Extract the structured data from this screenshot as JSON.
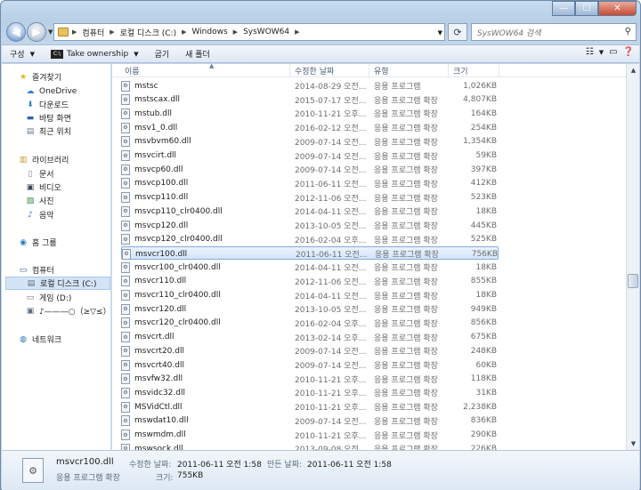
{
  "window": {
    "min_glyph": "—",
    "max_glyph": "☐",
    "close_glyph": "✕"
  },
  "address": {
    "path": [
      "컴퓨터",
      "로컬 디스크 (C:)",
      "Windows",
      "SysWOW64"
    ],
    "search_placeholder": "SysWOW64 검색"
  },
  "toolbar": {
    "organize": "구성",
    "take_ownership_icon": "C:\\",
    "take_ownership": "Take ownership",
    "burn": "굽기",
    "new_folder": "새 폴더"
  },
  "nav": {
    "favorites": "즐겨찾기",
    "onedrive": "OneDrive",
    "downloads": "다운로드",
    "desktop": "바탕 화면",
    "recent": "최근 위치",
    "libraries": "라이브러리",
    "documents": "문서",
    "videos": "비디오",
    "pictures": "사진",
    "music": "음악",
    "homegroup": "홈 그룹",
    "computer": "컴퓨터",
    "local_disk": "로컬 디스크 (C:)",
    "game_drive": "게임 (D:)",
    "odd_drive": "♪———○（≥▽≤）",
    "network": "네트워크"
  },
  "columns": {
    "name": "이름",
    "date": "수정한 날짜",
    "type": "유형",
    "size": "크기"
  },
  "files": [
    {
      "name": "mstsc",
      "date": "2014-08-29 오전...",
      "type": "응용 프로그램",
      "size": "1,026KB"
    },
    {
      "name": "mstscax.dll",
      "date": "2015-07-17 오전...",
      "type": "응용 프로그램 확장",
      "size": "4,807KB"
    },
    {
      "name": "mstub.dll",
      "date": "2010-11-21 오후...",
      "type": "응용 프로그램 확장",
      "size": "164KB"
    },
    {
      "name": "msv1_0.dll",
      "date": "2016-02-12 오전...",
      "type": "응용 프로그램 확장",
      "size": "254KB"
    },
    {
      "name": "msvbvm60.dll",
      "date": "2009-07-14 오전...",
      "type": "응용 프로그램 확장",
      "size": "1,354KB"
    },
    {
      "name": "msvcirt.dll",
      "date": "2009-07-14 오전...",
      "type": "응용 프로그램 확장",
      "size": "59KB"
    },
    {
      "name": "msvcp60.dll",
      "date": "2009-07-14 오전...",
      "type": "응용 프로그램 확장",
      "size": "397KB"
    },
    {
      "name": "msvcp100.dll",
      "date": "2011-06-11 오전...",
      "type": "응용 프로그램 확장",
      "size": "412KB"
    },
    {
      "name": "msvcp110.dll",
      "date": "2012-11-06 오전...",
      "type": "응용 프로그램 확장",
      "size": "523KB"
    },
    {
      "name": "msvcp110_clr0400.dll",
      "date": "2014-04-11 오전...",
      "type": "응용 프로그램 확장",
      "size": "18KB"
    },
    {
      "name": "msvcp120.dll",
      "date": "2013-10-05 오전...",
      "type": "응용 프로그램 확장",
      "size": "445KB"
    },
    {
      "name": "msvcp120_clr0400.dll",
      "date": "2016-02-04 오후...",
      "type": "응용 프로그램 확장",
      "size": "525KB"
    },
    {
      "name": "msvcr100.dll",
      "date": "2011-06-11 오전...",
      "type": "응용 프로그램 확장",
      "size": "756KB"
    },
    {
      "name": "msvcr100_clr0400.dll",
      "date": "2014-04-11 오전...",
      "type": "응용 프로그램 확장",
      "size": "18KB"
    },
    {
      "name": "msvcr110.dll",
      "date": "2012-11-06 오전...",
      "type": "응용 프로그램 확장",
      "size": "855KB"
    },
    {
      "name": "msvcr110_clr0400.dll",
      "date": "2014-04-11 오전...",
      "type": "응용 프로그램 확장",
      "size": "18KB"
    },
    {
      "name": "msvcr120.dll",
      "date": "2013-10-05 오전...",
      "type": "응용 프로그램 확장",
      "size": "949KB"
    },
    {
      "name": "msvcr120_clr0400.dll",
      "date": "2016-02-04 오후...",
      "type": "응용 프로그램 확장",
      "size": "856KB"
    },
    {
      "name": "msvcrt.dll",
      "date": "2013-02-14 오후...",
      "type": "응용 프로그램 확장",
      "size": "675KB"
    },
    {
      "name": "msvcrt20.dll",
      "date": "2009-07-14 오전...",
      "type": "응용 프로그램 확장",
      "size": "248KB"
    },
    {
      "name": "msvcrt40.dll",
      "date": "2009-07-14 오전...",
      "type": "응용 프로그램 확장",
      "size": "60KB"
    },
    {
      "name": "msvfw32.dll",
      "date": "2010-11-21 오후...",
      "type": "응용 프로그램 확장",
      "size": "118KB"
    },
    {
      "name": "msvidc32.dll",
      "date": "2010-11-21 오후...",
      "type": "응용 프로그램 확장",
      "size": "31KB"
    },
    {
      "name": "MSVidCtl.dll",
      "date": "2010-11-21 오후...",
      "type": "응용 프로그램 확장",
      "size": "2,238KB"
    },
    {
      "name": "mswdat10.dll",
      "date": "2009-07-14 오전...",
      "type": "응용 프로그램 확장",
      "size": "836KB"
    },
    {
      "name": "mswmdm.dll",
      "date": "2010-11-21 오후...",
      "type": "응용 프로그램 확장",
      "size": "290KB"
    },
    {
      "name": "mswsock.dll",
      "date": "2013-09-08 오전...",
      "type": "응용 프로그램 확장",
      "size": "226KB"
    }
  ],
  "selected_file_name": "msvcr100.dll",
  "details": {
    "name": "msvcr100.dll",
    "type": "응용 프로그램 확장",
    "modified_label": "수정한 날짜:",
    "modified_value": "2011-06-11 오전 1:58",
    "created_label": "만든 날짜:",
    "created_value": "2011-06-11 오전 1:58",
    "size_label": "크기:",
    "size_value": "755KB"
  }
}
